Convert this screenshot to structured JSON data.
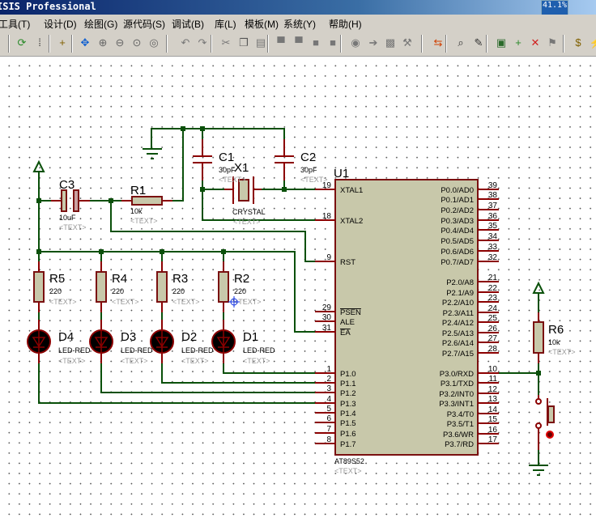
{
  "window": {
    "title": "ISIS Professional",
    "cpu_usage": "41.1%",
    "cpu_fraction": 0.411
  },
  "menu": [
    "工具(T)",
    "设计(D)",
    "绘图(G)",
    "源代码(S)",
    "调试(B)",
    "库(L)",
    "模板(M)",
    "系统(Y)",
    "帮助(H)"
  ],
  "toolbar": [
    {
      "icon": "refresh-icon",
      "glyph": "⟳",
      "color": "#2a8a2a"
    },
    {
      "icon": "grid-icon",
      "glyph": "⁞",
      "color": "#333"
    },
    {
      "icon": "origin-icon",
      "glyph": "+",
      "color": "#806000"
    },
    {
      "icon": "pan-icon",
      "glyph": "✥",
      "color": "#1060d0"
    },
    {
      "icon": "zoom-in-icon",
      "glyph": "⊕",
      "color": "#666"
    },
    {
      "icon": "zoom-out-icon",
      "glyph": "⊖",
      "color": "#666"
    },
    {
      "icon": "zoom-all-icon",
      "glyph": "⊙",
      "color": "#666"
    },
    {
      "icon": "zoom-area-icon",
      "glyph": "◎",
      "color": "#666"
    },
    {
      "icon": "undo-icon",
      "glyph": "↶",
      "color": "#777"
    },
    {
      "icon": "redo-icon",
      "glyph": "↷",
      "color": "#777"
    },
    {
      "icon": "cut-icon",
      "glyph": "✂",
      "color": "#777"
    },
    {
      "icon": "copy-icon",
      "glyph": "❐",
      "color": "#555"
    },
    {
      "icon": "paste-icon",
      "glyph": "▤",
      "color": "#777"
    },
    {
      "icon": "block-copy-icon",
      "glyph": "▀",
      "color": "#777"
    },
    {
      "icon": "block-move-icon",
      "glyph": "▀",
      "color": "#777"
    },
    {
      "icon": "block-rotate-icon",
      "glyph": "■",
      "color": "#777"
    },
    {
      "icon": "block-delete-icon",
      "glyph": "■",
      "color": "#777"
    },
    {
      "icon": "pick-device-icon",
      "glyph": "◉",
      "color": "#777"
    },
    {
      "icon": "make-device-icon",
      "glyph": "➔",
      "color": "#777"
    },
    {
      "icon": "package-tool-icon",
      "glyph": "▩",
      "color": "#777"
    },
    {
      "icon": "decompose-icon",
      "glyph": "⚒",
      "color": "#777"
    },
    {
      "icon": "wire-autorouter-icon",
      "glyph": "⇆",
      "color": "#d04000"
    },
    {
      "icon": "search-icon",
      "glyph": "⌕",
      "color": "#333"
    },
    {
      "icon": "property-tool-icon",
      "glyph": "✎",
      "color": "#333"
    },
    {
      "icon": "new-sheet-icon",
      "glyph": "▣",
      "color": "#2a6a2a"
    },
    {
      "icon": "add-sheet-icon",
      "glyph": "+",
      "color": "#2a8a2a"
    },
    {
      "icon": "remove-sheet-icon",
      "glyph": "✕",
      "color": "#d02020"
    },
    {
      "icon": "exit-parent-icon",
      "glyph": "⚑",
      "color": "#777"
    },
    {
      "icon": "bill-of-materials-icon",
      "glyph": "$",
      "color": "#806000"
    },
    {
      "icon": "erc-icon",
      "glyph": "⚡",
      "color": "#1060d0"
    }
  ],
  "schematic": {
    "U1": {
      "ref": "U1",
      "part": "AT89S52",
      "text": "<TEXT>",
      "left_pins": [
        {
          "num": "19",
          "label": "XTAL1",
          "bar": false
        },
        {
          "num": "18",
          "label": "XTAL2",
          "bar": false
        },
        {
          "num": "9",
          "label": "RST",
          "bar": false
        },
        {
          "num": "29",
          "label": "PSEN",
          "bar": true
        },
        {
          "num": "30",
          "label": "ALE",
          "bar": false
        },
        {
          "num": "31",
          "label": "EA",
          "bar": true
        },
        {
          "num": "1",
          "label": "P1.0",
          "bar": false
        },
        {
          "num": "2",
          "label": "P1.1",
          "bar": false
        },
        {
          "num": "3",
          "label": "P1.2",
          "bar": false
        },
        {
          "num": "4",
          "label": "P1.3",
          "bar": false
        },
        {
          "num": "5",
          "label": "P1.4",
          "bar": false
        },
        {
          "num": "6",
          "label": "P1.5",
          "bar": false
        },
        {
          "num": "7",
          "label": "P1.6",
          "bar": false
        },
        {
          "num": "8",
          "label": "P1.7",
          "bar": false
        }
      ],
      "right_pins": [
        {
          "num": "39",
          "label": "P0.0/AD0"
        },
        {
          "num": "38",
          "label": "P0.1/AD1"
        },
        {
          "num": "37",
          "label": "P0.2/AD2"
        },
        {
          "num": "36",
          "label": "P0.3/AD3"
        },
        {
          "num": "35",
          "label": "P0.4/AD4"
        },
        {
          "num": "34",
          "label": "P0.5/AD5"
        },
        {
          "num": "33",
          "label": "P0.6/AD6"
        },
        {
          "num": "32",
          "label": "P0.7/AD7"
        },
        {
          "num": "21",
          "label": "P2.0/A8"
        },
        {
          "num": "22",
          "label": "P2.1/A9"
        },
        {
          "num": "23",
          "label": "P2.2/A10"
        },
        {
          "num": "24",
          "label": "P2.3/A11"
        },
        {
          "num": "25",
          "label": "P2.4/A12"
        },
        {
          "num": "26",
          "label": "P2.5/A13"
        },
        {
          "num": "27",
          "label": "P2.6/A14"
        },
        {
          "num": "28",
          "label": "P2.7/A15"
        },
        {
          "num": "10",
          "label": "P3.0/RXD"
        },
        {
          "num": "11",
          "label": "P3.1/TXD"
        },
        {
          "num": "12",
          "label": "P3.2/INT0"
        },
        {
          "num": "13",
          "label": "P3.3/INT1"
        },
        {
          "num": "14",
          "label": "P3.4/T0"
        },
        {
          "num": "15",
          "label": "P3.5/T1"
        },
        {
          "num": "16",
          "label": "P3.6/WR"
        },
        {
          "num": "17",
          "label": "P3.7/RD"
        }
      ]
    },
    "C1": {
      "ref": "C1",
      "value": "30pF",
      "text": "<TEXT>"
    },
    "C2": {
      "ref": "C2",
      "value": "30pF",
      "text": "<TEXT>"
    },
    "C3": {
      "ref": "C3",
      "value": "10uF",
      "text": "<TEXT>"
    },
    "X1": {
      "ref": "X1",
      "value": "CRYSTAL",
      "text": "<TEXT>"
    },
    "R1": {
      "ref": "R1",
      "value": "10k",
      "text": "<TEXT>"
    },
    "R2": {
      "ref": "R2",
      "value": "220",
      "text": "<TEXT>"
    },
    "R3": {
      "ref": "R3",
      "value": "220",
      "text": "<TEXT>"
    },
    "R4": {
      "ref": "R4",
      "value": "220",
      "text": "<TEXT>"
    },
    "R5": {
      "ref": "R5",
      "value": "220",
      "text": "<TEXT>"
    },
    "R6": {
      "ref": "R6",
      "value": "10k",
      "text": "<TEXT>"
    },
    "D1": {
      "ref": "D1",
      "value": "LED-RED",
      "text": "<TEXT>"
    },
    "D2": {
      "ref": "D2",
      "value": "LED-RED",
      "text": "<TEXT>"
    },
    "D3": {
      "ref": "D3",
      "value": "LED-RED",
      "text": "<TEXT>"
    },
    "D4": {
      "ref": "D4",
      "value": "LED-RED",
      "text": "<TEXT>"
    }
  }
}
